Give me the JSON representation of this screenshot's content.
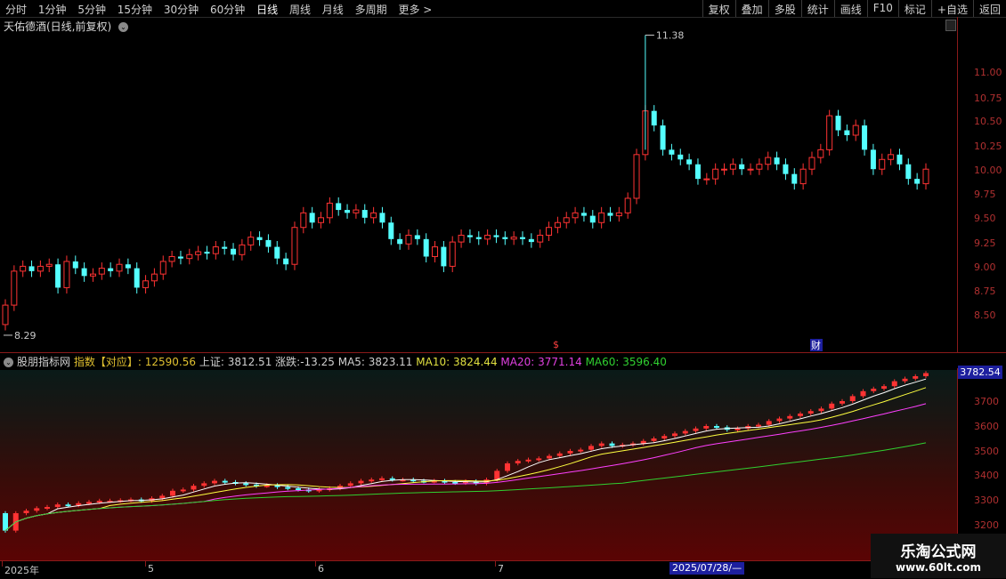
{
  "toolbar": {
    "periods": [
      "分时",
      "1分钟",
      "5分钟",
      "15分钟",
      "30分钟",
      "60分钟",
      "日线",
      "周线",
      "月线",
      "多周期",
      "更多 >"
    ],
    "active_period": "日线",
    "buttons": [
      "复权",
      "叠加",
      "多股",
      "统计",
      "画线",
      "F10",
      "标记",
      "+自选",
      "返回"
    ]
  },
  "main_chart": {
    "title": "天佑德酒(日线,前复权)",
    "price_axis": [
      "11.00",
      "10.75",
      "10.50",
      "10.25",
      "10.00",
      "9.75",
      "9.50",
      "9.25",
      "9.00",
      "8.75",
      "8.50"
    ],
    "high_marker": "11.38",
    "low_marker": "8.29",
    "event_marks": [
      "$",
      "财"
    ]
  },
  "indicator": {
    "name": "股朋指标网",
    "index_label": "指数【对应】",
    "index_value": "12590.56",
    "sh_label": "上证:",
    "sh_value": "3812.51",
    "change_label": "涨跌:",
    "change_value": "-13.25",
    "ma5_label": "MA5:",
    "ma5_value": "3823.11",
    "ma10_label": "MA10:",
    "ma10_value": "3824.44",
    "ma20_label": "MA20:",
    "ma20_value": "3771.14",
    "ma60_label": "MA60:",
    "ma60_value": "3596.40",
    "axis": [
      "3700",
      "3600",
      "3500",
      "3400",
      "3300",
      "3200"
    ],
    "current_value": "3782.54"
  },
  "date_axis": {
    "labels": [
      "2025年",
      "5",
      "6",
      "7"
    ],
    "highlight": "2025/07/28/—"
  },
  "watermark": {
    "line1": "乐淘公式网",
    "line2": "www.60lt.com"
  },
  "colors": {
    "up": "#ff3333",
    "down": "#54ffff",
    "ma5": "#ffffff",
    "ma10": "#ffff40",
    "ma20": "#ff40ff",
    "ma60": "#30d030",
    "axis_red": "#8b1a1a"
  },
  "chart_data": [
    {
      "type": "candlestick",
      "title": "天佑德酒(日线,前复权)",
      "y_range": [
        8.29,
        11.38
      ],
      "close_series": [
        8.6,
        8.95,
        9.0,
        8.95,
        9.0,
        9.02,
        8.78,
        9.05,
        8.98,
        8.9,
        8.92,
        8.98,
        8.95,
        9.02,
        8.98,
        8.78,
        8.85,
        8.92,
        9.05,
        9.1,
        9.08,
        9.12,
        9.15,
        9.13,
        9.2,
        9.18,
        9.12,
        9.22,
        9.3,
        9.27,
        9.2,
        9.08,
        9.02,
        9.4,
        9.55,
        9.45,
        9.5,
        9.65,
        9.58,
        9.55,
        9.58,
        9.5,
        9.55,
        9.45,
        9.28,
        9.23,
        9.32,
        9.28,
        9.1,
        9.2,
        9.0,
        9.25,
        9.32,
        9.3,
        9.28,
        9.32,
        9.3,
        9.28,
        9.3,
        9.28,
        9.25,
        9.32,
        9.4,
        9.45,
        9.5,
        9.55,
        9.52,
        9.45,
        9.55,
        9.52,
        9.55,
        9.7,
        10.15,
        10.6,
        10.45,
        10.2,
        10.15,
        10.1,
        10.05,
        9.9,
        9.9,
        10.0,
        10.0,
        10.05,
        10.0,
        10.0,
        10.05,
        10.12,
        10.05,
        9.95,
        9.85,
        10.0,
        10.12,
        10.2,
        10.55,
        10.4,
        10.35,
        10.45,
        10.2,
        10.0,
        10.1,
        10.15,
        10.05,
        9.9,
        9.85,
        10.0
      ]
    },
    {
      "type": "line",
      "title": "股朋指标网",
      "y_range": [
        3200,
        3782.54
      ],
      "series": [
        {
          "name": "MA5",
          "values": [
            3823.11
          ]
        },
        {
          "name": "MA10",
          "values": [
            3824.44
          ]
        },
        {
          "name": "MA20",
          "values": [
            3771.14
          ]
        },
        {
          "name": "MA60",
          "values": [
            3596.4
          ]
        }
      ],
      "index_close": [
        3180,
        3250,
        3260,
        3270,
        3275,
        3285,
        3282,
        3290,
        3295,
        3300,
        3300,
        3302,
        3305,
        3300,
        3310,
        3320,
        3340,
        3345,
        3360,
        3370,
        3380,
        3375,
        3370,
        3365,
        3360,
        3362,
        3355,
        3350,
        3345,
        3340,
        3345,
        3350,
        3360,
        3370,
        3380,
        3385,
        3390,
        3385,
        3385,
        3380,
        3378,
        3380,
        3375,
        3372,
        3378,
        3370,
        3385,
        3420,
        3450,
        3460,
        3465,
        3470,
        3480,
        3490,
        3500,
        3505,
        3520,
        3530,
        3520,
        3525,
        3530,
        3540,
        3550,
        3560,
        3570,
        3580,
        3590,
        3600,
        3595,
        3585,
        3590,
        3600,
        3605,
        3620,
        3630,
        3640,
        3650,
        3660,
        3670,
        3690,
        3700,
        3720,
        3740,
        3750,
        3760,
        3780,
        3790,
        3800,
        3812.51
      ],
      "close_last": 3812.51,
      "change": -13.25
    }
  ]
}
